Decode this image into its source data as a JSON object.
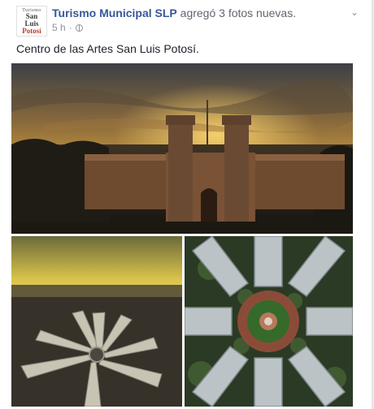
{
  "post": {
    "page_name": "Turismo Municipal SLP",
    "action_text": " agregó 3 fotos nuevas.",
    "timestamp": "5 h",
    "separator": "·",
    "caption": "Centro de las Artes San Luis Potosí.",
    "avatar": {
      "line1": "Turismo",
      "line2": "San",
      "line3": "Luis",
      "line4": "Potosí"
    }
  },
  "icons": {
    "privacy": "globe-icon",
    "menu": "chevron-down-icon"
  },
  "colors": {
    "link": "#365899",
    "secondary": "#90949c",
    "background": "#e9ebee"
  }
}
